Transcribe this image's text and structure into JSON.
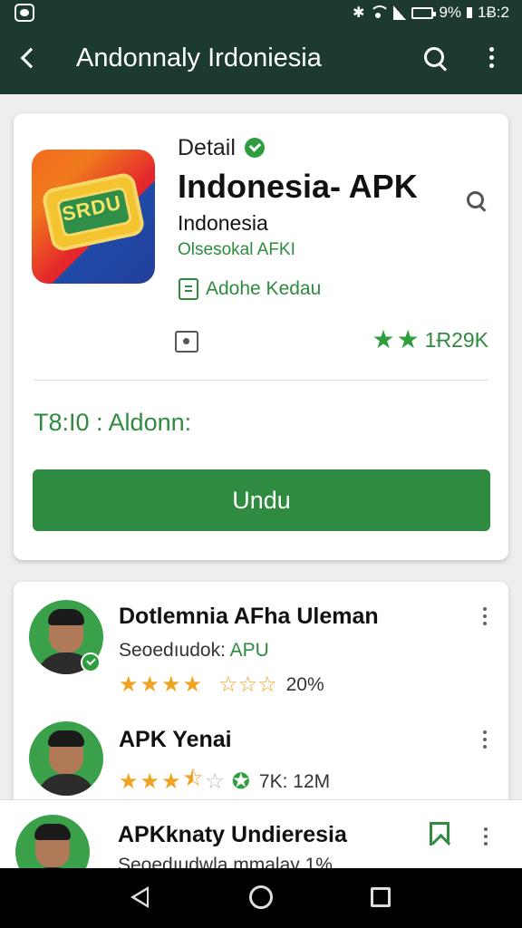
{
  "status_bar": {
    "time": "1Ƀ:2",
    "battery": "9%"
  },
  "app_bar": {
    "title": "Andonnaly Irdoniesia",
    "icons": [
      "back-icon",
      "search-icon",
      "more-icon"
    ]
  },
  "detail": {
    "label": "Detail",
    "app_name": "Indonesia- APK",
    "country": "Indonesia",
    "subtitle": "Olsesokal AFKI",
    "developer": "Adohe Kedau",
    "rating": "1Ɍ29K",
    "time_text": "T8:I0 : Aldonn:",
    "download_label": "Undu",
    "icon_text": "SRDU"
  },
  "reviews": [
    {
      "name": "Dotlemnia AFha Uleman",
      "sub_prefix": "Seoedıudok: ",
      "sub_accent": "APU",
      "stars_filled": 4,
      "meta": "20%",
      "verified": true
    },
    {
      "name": "APK Yenai",
      "stars_filled": 3,
      "meta": "7K: 12M",
      "verified": false
    }
  ],
  "bottom_item": {
    "name": "APKknaty Undieresia",
    "sub": "Seoedıudwla mmalay 1%"
  },
  "colors": {
    "app_bar": "#1d3a30",
    "accent_green": "#2e8b3f",
    "star_gold": "#f0a321"
  }
}
